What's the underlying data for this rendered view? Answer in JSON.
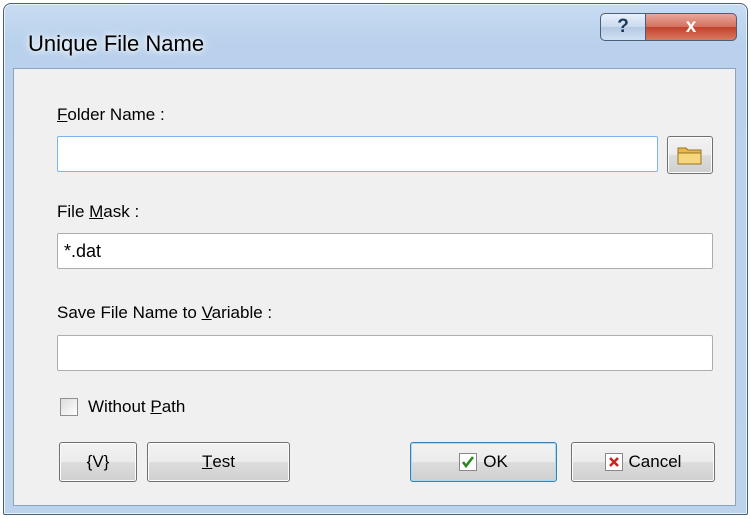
{
  "window": {
    "title": "Unique File Name",
    "help_label": "?",
    "close_label": "x"
  },
  "folder": {
    "label_accel": "F",
    "label_rest": "older Name :",
    "value": ""
  },
  "mask": {
    "label_pre": "File ",
    "label_accel": "M",
    "label_rest": "ask :",
    "value": "*.dat"
  },
  "variable": {
    "label_pre": "Save File Name to ",
    "label_accel": "V",
    "label_rest": "ariable :",
    "value": ""
  },
  "without_path": {
    "label_pre": "Without ",
    "label_accel": "P",
    "label_rest": "ath",
    "checked": false
  },
  "buttons": {
    "variables_label": "{V}",
    "test_accel": "T",
    "test_rest": "est",
    "ok_label": "OK",
    "cancel_label": "Cancel"
  },
  "colors": {
    "ok_check": "#2a8a1f",
    "cancel_x": "#c8281e",
    "folder_icon": "#e8b84a"
  }
}
